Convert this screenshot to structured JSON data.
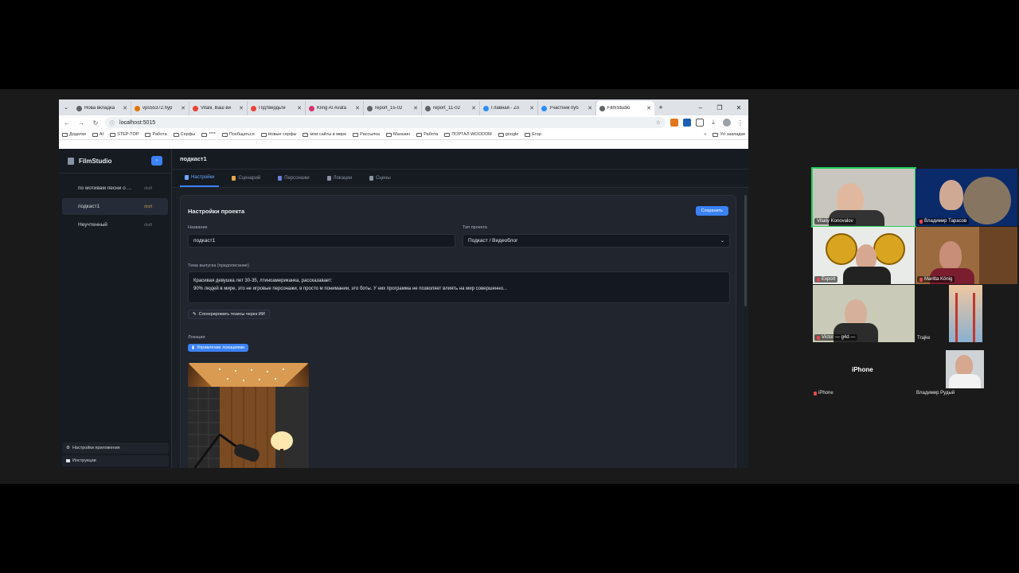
{
  "browser": {
    "tabs": [
      {
        "title": "Нова вкладка",
        "color": "#5f6368"
      },
      {
        "title": "vps55372.hyp",
        "color": "#e37400"
      },
      {
        "title": "Vitalii, Ваш ви",
        "color": "#ea4335"
      },
      {
        "title": "Підтвердьте",
        "color": "#ea4335"
      },
      {
        "title": "Kling AI Avata",
        "color": "#d6336c"
      },
      {
        "title": "report_15-02",
        "color": "#5f6368"
      },
      {
        "title": "report_11-02",
        "color": "#5f6368"
      },
      {
        "title": "Главная - Zo",
        "color": "#2d8cff"
      },
      {
        "title": "Участник пуб",
        "color": "#2d8cff"
      },
      {
        "title": "FilmStudio",
        "color": "#5f6368",
        "active": true
      }
    ],
    "new_tab": "+",
    "url": "localhost:5015",
    "bookmarks": [
      "Додатки",
      "AI",
      "STEP-TOP",
      "Работа",
      "Серфы",
      "****",
      "Пообщаться",
      "Новые серфы",
      "мои сайты в мире",
      "Рассылка",
      "Магазин",
      "Работа",
      "ПОРТАЛ WOODOM",
      "google",
      "Егор"
    ],
    "all_bookmarks": "Усі закладки"
  },
  "app": {
    "logo": "FilmStudio",
    "projects": [
      {
        "name": "по мотивам песни о ...",
        "status": "draft"
      },
      {
        "name": "подкаст1",
        "status": "draft",
        "active": true
      },
      {
        "name": "Неучтенный",
        "status": "draft"
      }
    ],
    "footer": {
      "settings": "Настройки приложения",
      "instructions": "Инструкции"
    },
    "project_title": "подкаст1",
    "tabs": [
      "Настройки",
      "Сценарий",
      "Персонажи",
      "Локации",
      "Сцены"
    ],
    "card": {
      "title": "Настройки проекта",
      "save": "Сохранить",
      "name_label": "Название",
      "name_value": "подкаст1",
      "type_label": "Тип проекта",
      "type_value": "Подкаст / Видеоблог",
      "topic_label": "Тема выпуска (предописание)",
      "topic_line1": "Красивая девушка лет 30-35, лтиноамериканка, рассказавает:",
      "topic_line2": "90% людей в мире, это не игровые персонажи, в просто м понимании, это боты. У них программа не позволяет влиять на мир совершенно...",
      "generate_btn": "Сгенерировать тезисы через ИИ",
      "locations_label": "Локации",
      "manage_locations": "Управление локациями"
    }
  },
  "zoom": {
    "participants": [
      {
        "name": "Vitaliy Konovalov",
        "muted": false
      },
      {
        "name": "Владимир Тарасов",
        "muted": true
      },
      {
        "name": "Export",
        "muted": true
      },
      {
        "name": "Maritta König",
        "muted": true
      },
      {
        "name": "Victor — g4d —",
        "muted": true
      },
      {
        "name": "Trajke",
        "muted": false
      }
    ],
    "iphone_center": "iPhone",
    "iphone_name": "iPhone",
    "rudyi_name": "Владимир Рудый"
  }
}
